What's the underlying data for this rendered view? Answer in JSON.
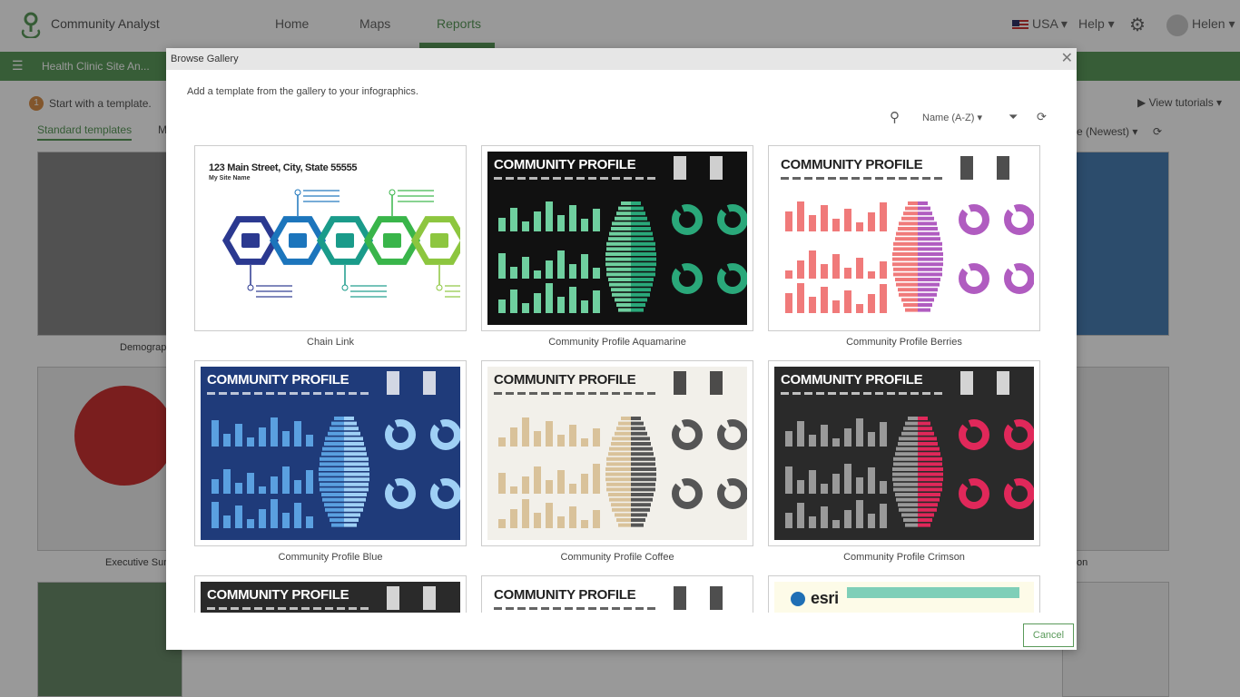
{
  "app": {
    "name": "Community Analyst",
    "nav": [
      "Home",
      "Maps",
      "Reports"
    ],
    "active_nav": "Reports",
    "country": "USA",
    "help": "Help",
    "user": "Helen"
  },
  "project": {
    "title": "Health Clinic Site An..."
  },
  "background": {
    "step_number": "1",
    "step_text": "Start with a template.",
    "tab": "Standard templates",
    "tab2": "M",
    "tutorials": "View tutorials",
    "sort": "e (Newest)",
    "captions": [
      "Demograp",
      "Executive Sum",
      "on"
    ]
  },
  "modal": {
    "title": "Browse Gallery",
    "intro": "Add a template from the gallery to your infographics.",
    "sort": "Name (A-Z)",
    "cancel": "Cancel",
    "templates": [
      {
        "name": "Chain Link",
        "style": "chain",
        "bg": "#ffffff",
        "fg": "#222222",
        "colors": [
          "#2b3990",
          "#1c75bc",
          "#1a9b8a",
          "#39b54a",
          "#8dc63f"
        ],
        "title": "123 Main Street, City, State 55555",
        "subtitle": "My Site Name"
      },
      {
        "name": "Community Profile Aquamarine",
        "style": "profile",
        "bg": "#111111",
        "fg": "#ffffff",
        "colors": [
          "#6fcf9f",
          "#2aa87a"
        ],
        "title": "COMMUNITY PROFILE"
      },
      {
        "name": "Community Profile Berries",
        "style": "profile",
        "bg": "#ffffff",
        "fg": "#222222",
        "colors": [
          "#f07a7a",
          "#b05cc0"
        ],
        "title": "COMMUNITY PROFILE"
      },
      {
        "name": "Community Profile Blue",
        "style": "profile",
        "bg": "#1f3b7a",
        "fg": "#ffffff",
        "colors": [
          "#5aa0e0",
          "#9fd0f5"
        ],
        "title": "COMMUNITY PROFILE"
      },
      {
        "name": "Community Profile Coffee",
        "style": "profile",
        "bg": "#f2f0ea",
        "fg": "#222222",
        "colors": [
          "#d9c29a",
          "#555555"
        ],
        "title": "COMMUNITY PROFILE"
      },
      {
        "name": "Community Profile Crimson",
        "style": "profile",
        "bg": "#2a2a2a",
        "fg": "#ffffff",
        "colors": [
          "#999999",
          "#e0285a"
        ],
        "title": "COMMUNITY PROFILE"
      },
      {
        "name": "",
        "style": "profile",
        "bg": "#2a2a2a",
        "fg": "#ffffff",
        "colors": [
          "#888888",
          "#cccccc"
        ],
        "title": "COMMUNITY PROFILE"
      },
      {
        "name": "",
        "style": "profile",
        "bg": "#ffffff",
        "fg": "#222222",
        "colors": [
          "#1a9b8a",
          "#1c75bc"
        ],
        "title": "COMMUNITY PROFILE"
      },
      {
        "name": "",
        "style": "esri",
        "bg": "#fdfbe8",
        "fg": "#222222",
        "colors": [
          "#7fcfb8",
          "#2e7d32"
        ],
        "title": "esri"
      }
    ]
  }
}
